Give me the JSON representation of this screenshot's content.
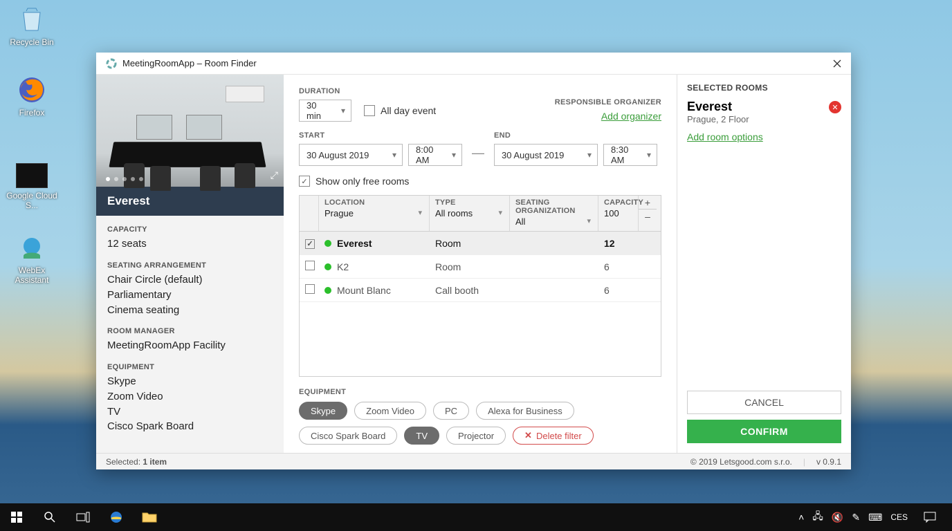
{
  "desktop": {
    "icons": [
      {
        "label": "Recycle Bin"
      },
      {
        "label": "Firefox"
      },
      {
        "label": "Google Cloud S..."
      },
      {
        "label": "WebEx Assistant"
      }
    ]
  },
  "window": {
    "title": "MeetingRoomApp – Room Finder"
  },
  "detail": {
    "room_name": "Everest",
    "sections": {
      "capacity_label": "CAPACITY",
      "capacity_value": "12 seats",
      "seating_label": "SEATING ARRANGEMENT",
      "seating_values": [
        "Chair Circle (default)",
        "Parliamentary",
        "Cinema seating"
      ],
      "manager_label": "ROOM MANAGER",
      "manager_value": "MeetingRoomApp Facility",
      "equipment_label": "EQUIPMENT",
      "equipment_values": [
        "Skype",
        "Zoom Video",
        "TV",
        "Cisco Spark Board"
      ]
    }
  },
  "form": {
    "duration_label": "DURATION",
    "duration_value": "30 min",
    "all_day_label": "All day event",
    "all_day_checked": false,
    "organizer_label": "RESPONSIBLE ORGANIZER",
    "add_organizer": "Add organizer",
    "start_label": "START",
    "start_date": "30 August 2019",
    "start_time": "8:00 AM",
    "end_label": "END",
    "end_date": "30 August 2019",
    "end_time": "8:30 AM",
    "free_only_label": "Show only free rooms",
    "free_only_checked": true
  },
  "grid": {
    "head": {
      "location_label": "LOCATION",
      "location_value": "Prague",
      "type_label": "TYPE",
      "type_value": "All rooms",
      "seating_label": "SEATING ORGANIZATION",
      "seating_value": "All",
      "capacity_label": "CAPACITY",
      "capacity_value": "100",
      "plus": "+",
      "minus": "–"
    },
    "rows": [
      {
        "checked": true,
        "name": "Everest",
        "type": "Room",
        "capacity": "12"
      },
      {
        "checked": false,
        "name": "K2",
        "type": "Room",
        "capacity": "6"
      },
      {
        "checked": false,
        "name": "Mount Blanc",
        "type": "Call booth",
        "capacity": "6"
      }
    ]
  },
  "equipment": {
    "label": "EQUIPMENT",
    "pills": [
      {
        "label": "Skype",
        "on": true
      },
      {
        "label": "Zoom Video",
        "on": false
      },
      {
        "label": "PC",
        "on": false
      },
      {
        "label": "Alexa for Business",
        "on": false
      },
      {
        "label": "Cisco Spark Board",
        "on": false
      },
      {
        "label": "TV",
        "on": true
      },
      {
        "label": "Projector",
        "on": false
      }
    ],
    "delete_label": "Delete filter"
  },
  "selected": {
    "header": "SELECTED ROOMS",
    "room_name": "Everest",
    "room_location": "Prague, 2 Floor",
    "add_options": "Add room options",
    "cancel": "CANCEL",
    "confirm": "CONFIRM"
  },
  "status": {
    "selected_prefix": "Selected: ",
    "selected_count": "1 item",
    "copyright": "© 2019 Letsgood.com s.r.o.",
    "version": "v 0.9.1"
  },
  "taskbar": {
    "language": "CES"
  }
}
